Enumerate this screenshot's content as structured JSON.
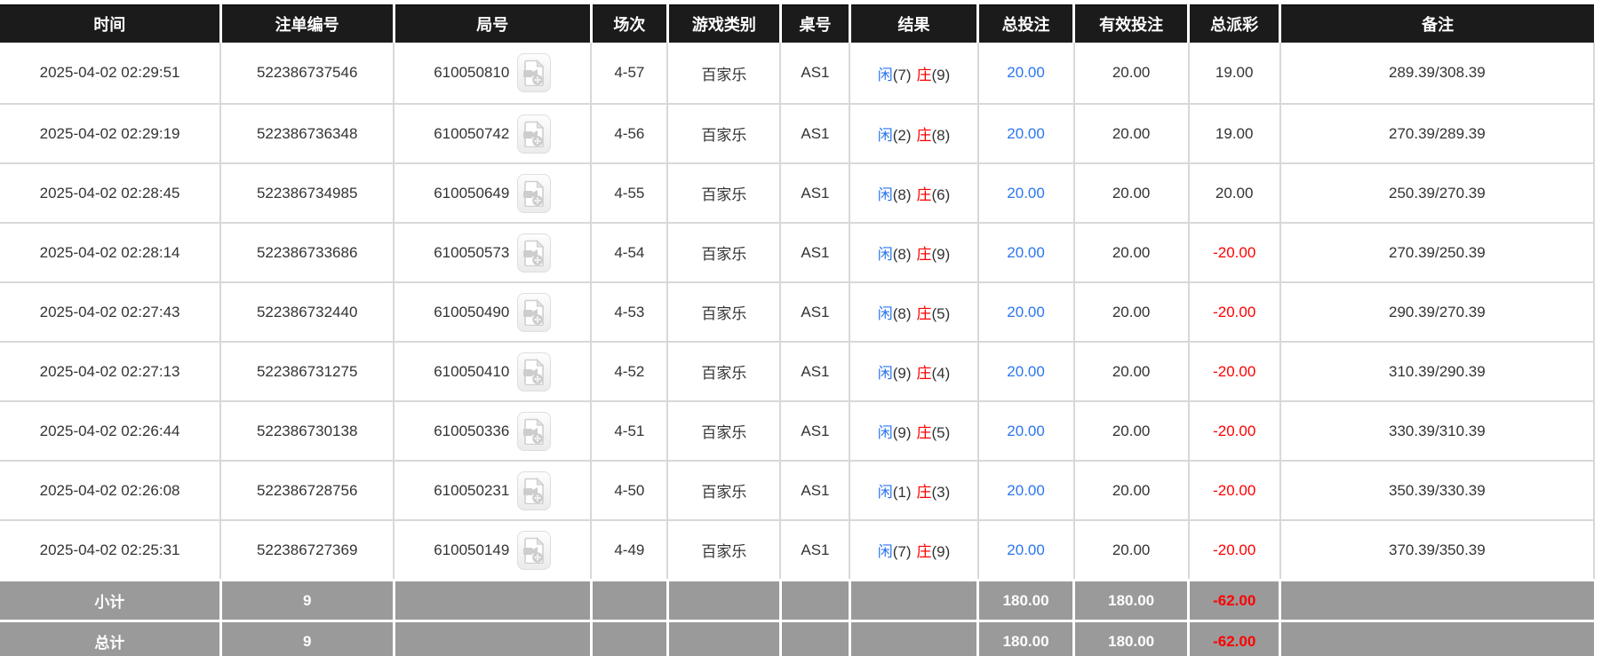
{
  "colors": {
    "header_bg": "#1b1b1b",
    "header_text": "#ffffff",
    "row_border": "#d8d8d8",
    "summary_bg": "#9a9a9a",
    "link_blue": "#2b76f0",
    "player_blue": "#2b76f0",
    "banker_red": "#ff0000",
    "negative_red": "#ff0000",
    "body_text": "#333333"
  },
  "icons": {
    "video_replay": "video-replay-icon"
  },
  "table": {
    "columns": [
      {
        "key": "time",
        "label": "时间"
      },
      {
        "key": "bet_id",
        "label": "注单编号"
      },
      {
        "key": "round_id",
        "label": "局号"
      },
      {
        "key": "session",
        "label": "场次"
      },
      {
        "key": "game_type",
        "label": "游戏类别"
      },
      {
        "key": "table_no",
        "label": "桌号"
      },
      {
        "key": "result",
        "label": "结果"
      },
      {
        "key": "total_bet",
        "label": "总投注"
      },
      {
        "key": "valid_bet",
        "label": "有效投注"
      },
      {
        "key": "total_payout",
        "label": "总派彩"
      },
      {
        "key": "remark",
        "label": "备注"
      }
    ],
    "rows": [
      {
        "time": "2025-04-02 02:29:51",
        "bet_id": "522386737546",
        "round_id": "610050810",
        "session": "4-57",
        "game_type": "百家乐",
        "table_no": "AS1",
        "result": {
          "player_label": "闲",
          "player_score": "(7)",
          "banker_label": "庄",
          "banker_score": "(9)"
        },
        "total_bet": "20.00",
        "valid_bet": "20.00",
        "total_payout": "19.00",
        "remark": "289.39/308.39"
      },
      {
        "time": "2025-04-02 02:29:19",
        "bet_id": "522386736348",
        "round_id": "610050742",
        "session": "4-56",
        "game_type": "百家乐",
        "table_no": "AS1",
        "result": {
          "player_label": "闲",
          "player_score": "(2)",
          "banker_label": "庄",
          "banker_score": "(8)"
        },
        "total_bet": "20.00",
        "valid_bet": "20.00",
        "total_payout": "19.00",
        "remark": "270.39/289.39"
      },
      {
        "time": "2025-04-02 02:28:45",
        "bet_id": "522386734985",
        "round_id": "610050649",
        "session": "4-55",
        "game_type": "百家乐",
        "table_no": "AS1",
        "result": {
          "player_label": "闲",
          "player_score": "(8)",
          "banker_label": "庄",
          "banker_score": "(6)"
        },
        "total_bet": "20.00",
        "valid_bet": "20.00",
        "total_payout": "20.00",
        "remark": "250.39/270.39"
      },
      {
        "time": "2025-04-02 02:28:14",
        "bet_id": "522386733686",
        "round_id": "610050573",
        "session": "4-54",
        "game_type": "百家乐",
        "table_no": "AS1",
        "result": {
          "player_label": "闲",
          "player_score": "(8)",
          "banker_label": "庄",
          "banker_score": "(9)"
        },
        "total_bet": "20.00",
        "valid_bet": "20.00",
        "total_payout": "-20.00",
        "remark": "270.39/250.39"
      },
      {
        "time": "2025-04-02 02:27:43",
        "bet_id": "522386732440",
        "round_id": "610050490",
        "session": "4-53",
        "game_type": "百家乐",
        "table_no": "AS1",
        "result": {
          "player_label": "闲",
          "player_score": "(8)",
          "banker_label": "庄",
          "banker_score": "(5)"
        },
        "total_bet": "20.00",
        "valid_bet": "20.00",
        "total_payout": "-20.00",
        "remark": "290.39/270.39"
      },
      {
        "time": "2025-04-02 02:27:13",
        "bet_id": "522386731275",
        "round_id": "610050410",
        "session": "4-52",
        "game_type": "百家乐",
        "table_no": "AS1",
        "result": {
          "player_label": "闲",
          "player_score": "(9)",
          "banker_label": "庄",
          "banker_score": "(4)"
        },
        "total_bet": "20.00",
        "valid_bet": "20.00",
        "total_payout": "-20.00",
        "remark": "310.39/290.39"
      },
      {
        "time": "2025-04-02 02:26:44",
        "bet_id": "522386730138",
        "round_id": "610050336",
        "session": "4-51",
        "game_type": "百家乐",
        "table_no": "AS1",
        "result": {
          "player_label": "闲",
          "player_score": "(9)",
          "banker_label": "庄",
          "banker_score": "(5)"
        },
        "total_bet": "20.00",
        "valid_bet": "20.00",
        "total_payout": "-20.00",
        "remark": "330.39/310.39"
      },
      {
        "time": "2025-04-02 02:26:08",
        "bet_id": "522386728756",
        "round_id": "610050231",
        "session": "4-50",
        "game_type": "百家乐",
        "table_no": "AS1",
        "result": {
          "player_label": "闲",
          "player_score": "(1)",
          "banker_label": "庄",
          "banker_score": "(3)"
        },
        "total_bet": "20.00",
        "valid_bet": "20.00",
        "total_payout": "-20.00",
        "remark": "350.39/330.39"
      },
      {
        "time": "2025-04-02 02:25:31",
        "bet_id": "522386727369",
        "round_id": "610050149",
        "session": "4-49",
        "game_type": "百家乐",
        "table_no": "AS1",
        "result": {
          "player_label": "闲",
          "player_score": "(7)",
          "banker_label": "庄",
          "banker_score": "(9)"
        },
        "total_bet": "20.00",
        "valid_bet": "20.00",
        "total_payout": "-20.00",
        "remark": "370.39/350.39"
      }
    ],
    "summary_rows": [
      {
        "name": "subtotal",
        "label": "小计",
        "count": "9",
        "total_bet": "180.00",
        "valid_bet": "180.00",
        "total_payout": "-62.00"
      },
      {
        "name": "total",
        "label": "总计",
        "count": "9",
        "total_bet": "180.00",
        "valid_bet": "180.00",
        "total_payout": "-62.00"
      }
    ]
  }
}
